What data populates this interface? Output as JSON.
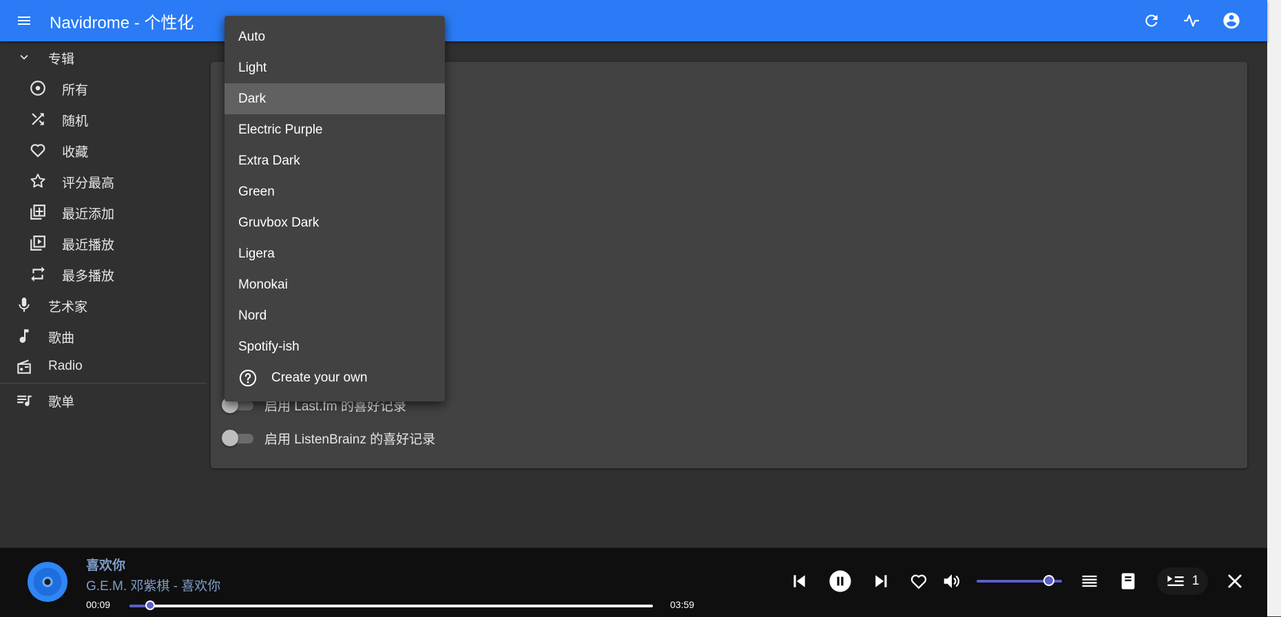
{
  "app": {
    "title": "Navidrome - 个性化"
  },
  "colors": {
    "appbar": "#2a7bf5",
    "background": "#303030",
    "card": "#424242",
    "accent": "#5c5fc7",
    "player": "#0f0f0f"
  },
  "appbar_icons": [
    "menu-icon",
    "refresh-icon",
    "activity-icon",
    "account-icon"
  ],
  "sidebar": {
    "section": {
      "label": "专辑",
      "icon": "chevron-down-icon"
    },
    "album_items": [
      {
        "label": "所有",
        "icon": "album-icon"
      },
      {
        "label": "随机",
        "icon": "shuffle-icon"
      },
      {
        "label": "收藏",
        "icon": "heart-icon"
      },
      {
        "label": "评分最高",
        "icon": "star-icon"
      },
      {
        "label": "最近添加",
        "icon": "library-add-icon"
      },
      {
        "label": "最近播放",
        "icon": "video-library-icon"
      },
      {
        "label": "最多播放",
        "icon": "repeat-icon"
      }
    ],
    "items": [
      {
        "label": "艺术家",
        "icon": "mic-icon"
      },
      {
        "label": "歌曲",
        "icon": "music-note-icon"
      },
      {
        "label": "Radio",
        "icon": "radio-icon"
      }
    ],
    "playlists": {
      "label": "歌单",
      "icon": "queue-music-icon"
    }
  },
  "theme_menu": {
    "options": [
      "Auto",
      "Light",
      "Dark",
      "Electric Purple",
      "Extra Dark",
      "Green",
      "Gruvbox Dark",
      "Ligera",
      "Monokai",
      "Nord",
      "Spotify-ish"
    ],
    "selected": "Dark",
    "create_own": "Create your own"
  },
  "settings": {
    "lastfm_label": "启用 Last.fm 的喜好记录",
    "listenbrainz_label": "启用 ListenBrainz 的喜好记录",
    "lastfm_enabled": false,
    "listenbrainz_enabled": false
  },
  "player": {
    "title": "喜欢你",
    "artist_line": "G.E.M. 邓紫棋 - 喜欢你",
    "current_time": "00:09",
    "duration": "03:59",
    "progress_fraction": 0.04,
    "volume_fraction": 0.85,
    "queue_count": "1"
  }
}
